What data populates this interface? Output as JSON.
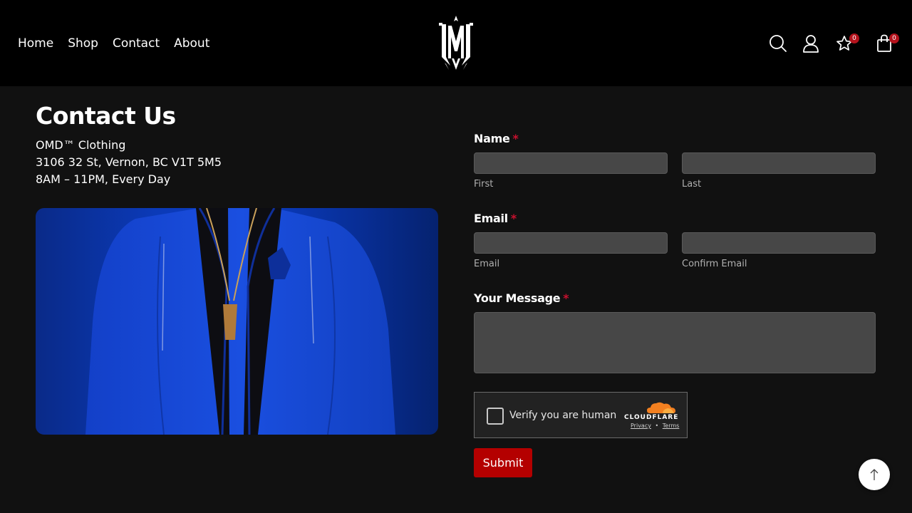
{
  "nav": {
    "items": [
      {
        "label": "Home"
      },
      {
        "label": "Shop"
      },
      {
        "label": "Contact"
      },
      {
        "label": "About"
      }
    ]
  },
  "header_actions": {
    "search_icon": "search-icon",
    "account_icon": "user-icon",
    "wishlist_icon": "star-icon",
    "wishlist_count": "0",
    "cart_icon": "bag-icon",
    "cart_count": "0"
  },
  "contact": {
    "title": "Contact Us",
    "business_name": "OMD™ Clothing",
    "address": "3106 32 St, Vernon, BC V1T 5M5",
    "hours": "8AM – 11PM, Every Day"
  },
  "form": {
    "name_label": "Name",
    "first_sub": "First",
    "last_sub": "Last",
    "email_label": "Email",
    "email_sub": "Email",
    "confirm_email_sub": "Confirm Email",
    "message_label": "Your Message",
    "required_mark": "*",
    "first_value": "",
    "last_value": "",
    "email_value": "",
    "confirm_email_value": "",
    "message_value": "",
    "submit_label": "Submit"
  },
  "captcha": {
    "text": "Verify you are human",
    "brand": "CLOUDFLARE",
    "privacy": "Privacy",
    "separator": "•",
    "terms": "Terms"
  },
  "colors": {
    "header_bg": "#000000",
    "page_bg": "#111111",
    "accent": "#b40000",
    "field_bg": "#474747"
  }
}
